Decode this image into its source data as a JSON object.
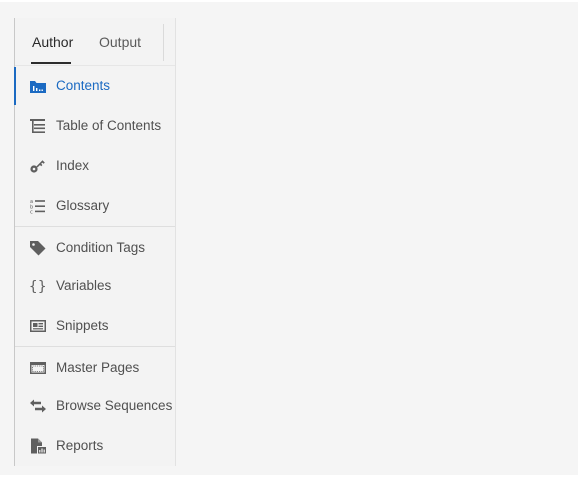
{
  "tabs": [
    {
      "label": "Author",
      "selected": true
    },
    {
      "label": "Output",
      "selected": false
    }
  ],
  "nav": {
    "items": [
      {
        "label": "Contents",
        "icon": "contents-icon",
        "active": true
      },
      {
        "label": "Table of Contents",
        "icon": "table-of-contents-icon",
        "active": false
      },
      {
        "label": "Index",
        "icon": "key-icon",
        "active": false
      },
      {
        "label": "Glossary",
        "icon": "glossary-icon",
        "active": false
      },
      {
        "label": "Condition Tags",
        "icon": "tag-icon",
        "active": false
      },
      {
        "label": "Variables",
        "icon": "curly-braces-icon",
        "active": false
      },
      {
        "label": "Snippets",
        "icon": "snippet-icon",
        "active": false
      },
      {
        "label": "Master Pages",
        "icon": "master-page-icon",
        "active": false
      },
      {
        "label": "Browse Sequences",
        "icon": "browse-sequence-icon",
        "active": false
      },
      {
        "label": "Reports",
        "icon": "report-icon",
        "active": false
      }
    ]
  },
  "colors": {
    "accent": "#1b6ac2",
    "icon": "#5f5f5f",
    "panel_bg": "#f3f3f3",
    "canvas_bg": "#f5f5f5"
  }
}
